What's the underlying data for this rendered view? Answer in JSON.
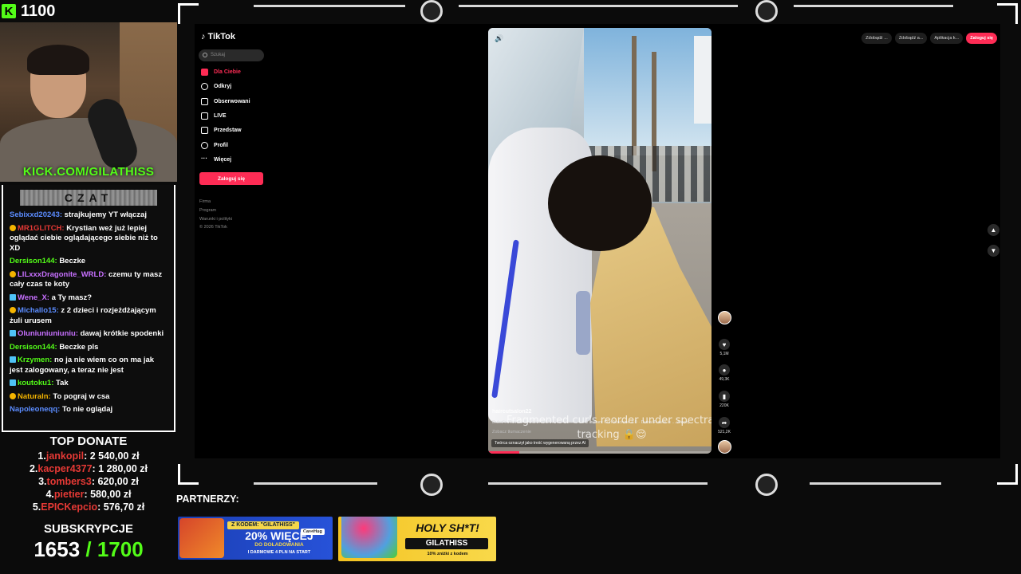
{
  "kick": {
    "count": "1100",
    "url": "KICK.COM/GILATHISS"
  },
  "chat": {
    "title": "CZAT",
    "messages": [
      {
        "user": "Sebixxd20243:",
        "text": "strajkujemy YT włączaj",
        "color": "#5b8cff",
        "badge": ""
      },
      {
        "user": "MR1GLITCH:",
        "text": "Krystian weż już lepiej oglądać ciebie oglądającego siebie niż to XD",
        "color": "#e53935",
        "badge": "sub"
      },
      {
        "user": "Dersison144:",
        "text": "Beczke",
        "color": "#53fc18",
        "badge": ""
      },
      {
        "user": "LILxxxDragonite_WRLD:",
        "text": "czemu ty masz cały czas te koty",
        "color": "#c770ff",
        "badge": "sub"
      },
      {
        "user": "Wene_X:",
        "text": "a Ty masz?",
        "color": "#c770ff",
        "badge": "sw"
      },
      {
        "user": "Michallo15:",
        "text": "z 2 dzieci i rozjeżdżającym żuli urusem",
        "color": "#5b8cff",
        "badge": "sub"
      },
      {
        "user": "Oluniuniuniuniu:",
        "text": "dawaj krótkie spodenki",
        "color": "#c770ff",
        "badge": "sw"
      },
      {
        "user": "Dersison144:",
        "text": "Beczke pls",
        "color": "#53fc18",
        "badge": ""
      },
      {
        "user": "Krzymen:",
        "text": "no ja nie wiem co on ma jak jest zalogowany, a teraz nie jest",
        "color": "#53fc18",
        "badge": "sw"
      },
      {
        "user": "koutoku1:",
        "text": "Tak",
        "color": "#53fc18",
        "badge": "sw"
      },
      {
        "user": "Naturaln:",
        "text": "To pograj w csa",
        "color": "#f4b400",
        "badge": "sub"
      },
      {
        "user": "Napoleoneqq:",
        "text": "To nie oglądaj",
        "color": "#5b8cff",
        "badge": ""
      }
    ]
  },
  "top_donate": {
    "title": "TOP DONATE",
    "entries": [
      {
        "rank": "1.",
        "name": "jankopil",
        "amount": ": 2 540,00 zł"
      },
      {
        "rank": "2.",
        "name": "kacper4377",
        "amount": ": 1 280,00 zł"
      },
      {
        "rank": "3.",
        "name": "tombers3",
        "amount": ": 620,00 zł"
      },
      {
        "rank": "4.",
        "name": "pietier",
        "amount": ": 580,00 zł"
      },
      {
        "rank": "5.",
        "name": "EPICKepcio",
        "amount": ": 576,70 zł"
      }
    ]
  },
  "subs": {
    "title": "SUBSKRYPCJE",
    "current": "1653",
    "goal": " / 1700"
  },
  "tiktok": {
    "logo": "TikTok",
    "search_placeholder": "Szukaj",
    "nav": [
      "Dla Ciebie",
      "Odkryj",
      "Obserwowani",
      "LIVE",
      "Przedstaw",
      "Profil",
      "Więcej"
    ],
    "login": "Zaloguj się",
    "footer": [
      "Firma",
      "Program",
      "Warunki i polityki",
      "© 2026 TikTok"
    ],
    "top_right": [
      "Zdobądź ...",
      "Zdobądź a...",
      "Aplikacja k...",
      "Zaloguj się"
    ],
    "video": {
      "user": "haircutsalon22",
      "desc": "Dubai's Newest AI Salon Robot Will Shock You AI Instant Curl Machine 4.0 · Dubai Future is ... więcej",
      "translate": "Zobacz tłumaczenie",
      "ai_label": "Twórca oznaczył jako treść wygenerowaną przez AI",
      "subtitle": "Fragmented curls reorder under spectral tracking 🔒😌",
      "progress": 0.14
    },
    "actions": [
      {
        "icon": "heart-icon",
        "glyph": "♥",
        "count": "5,1M"
      },
      {
        "icon": "comment-icon",
        "glyph": "●",
        "count": "49,3K"
      },
      {
        "icon": "bookmark-icon",
        "glyph": "▮",
        "count": "220K"
      },
      {
        "icon": "share-icon",
        "glyph": "➦",
        "count": "521,2K"
      }
    ]
  },
  "partners": {
    "label": "PARTNERZY:",
    "ad1": {
      "code": "Z KODEM: \"GILATHISS\"",
      "brand": "CaseHug",
      "big": "20% WIĘCEJ",
      "sub": "DO DOŁADOWANIA",
      "sub2": "I DARMOWE 4 PLN NA START"
    },
    "ad2": {
      "big": "HOLY SH*T!",
      "code": "GILATHISS",
      "sub": "10% zniżki z kodem"
    }
  }
}
